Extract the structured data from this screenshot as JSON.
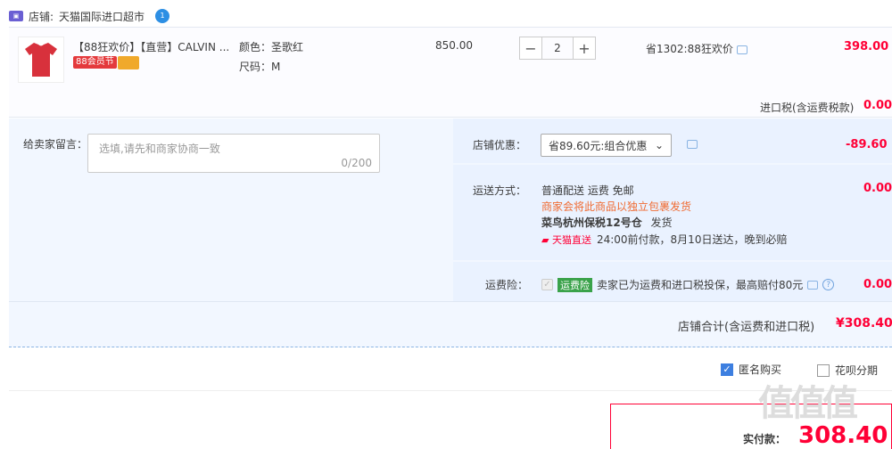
{
  "store": {
    "icon": "store-icon",
    "label": "店铺:",
    "name": "天猫国际进口超市",
    "msg_badge": "1"
  },
  "item": {
    "title": "【88狂欢价】【直营】CALVIN ...",
    "tag_88": "88会员节",
    "color": "颜色：圣歌红",
    "size": "尺码：M",
    "unit_price": "850.00",
    "quantity": "2",
    "minus": "−",
    "plus": "+",
    "discount_note": "省1302:88狂欢价",
    "subtotal": "398.00",
    "thumb_color": "#d8313c"
  },
  "tax": {
    "label": "进口税(含运费税款)",
    "value": "0.00"
  },
  "message": {
    "label": "给卖家留言：",
    "placeholder": "选填,请先和商家协商一致",
    "counter": "0/200"
  },
  "store_discount": {
    "label": "店铺优惠：",
    "selected": "省89.60元:组合优惠",
    "value": "-89.60"
  },
  "shipping": {
    "label": "运送方式：",
    "method": "普通配送 运费 免邮",
    "notice": "商家会将此商品以独立包裹发货",
    "warehouse": "菜鸟杭州保税12号仓",
    "ship_word": "发货",
    "tmall_tag": "天猫直送",
    "eta": "24:00前付款，8月10日送达，晚到必赔",
    "value": "0.00"
  },
  "insurance": {
    "label": "运费险：",
    "badge": "运费险",
    "text": "卖家已为运费和进口税投保，最高赔付80元",
    "help": "?",
    "value": "0.00"
  },
  "store_total": {
    "label": "店铺合计(含运费和进口税)",
    "currency": "¥",
    "value": "308.40"
  },
  "options": {
    "anonymous": "匿名购买",
    "huabei": "花呗分期"
  },
  "payment": {
    "label": "实付款：",
    "value": "308.40"
  },
  "watermark": "值值值"
}
